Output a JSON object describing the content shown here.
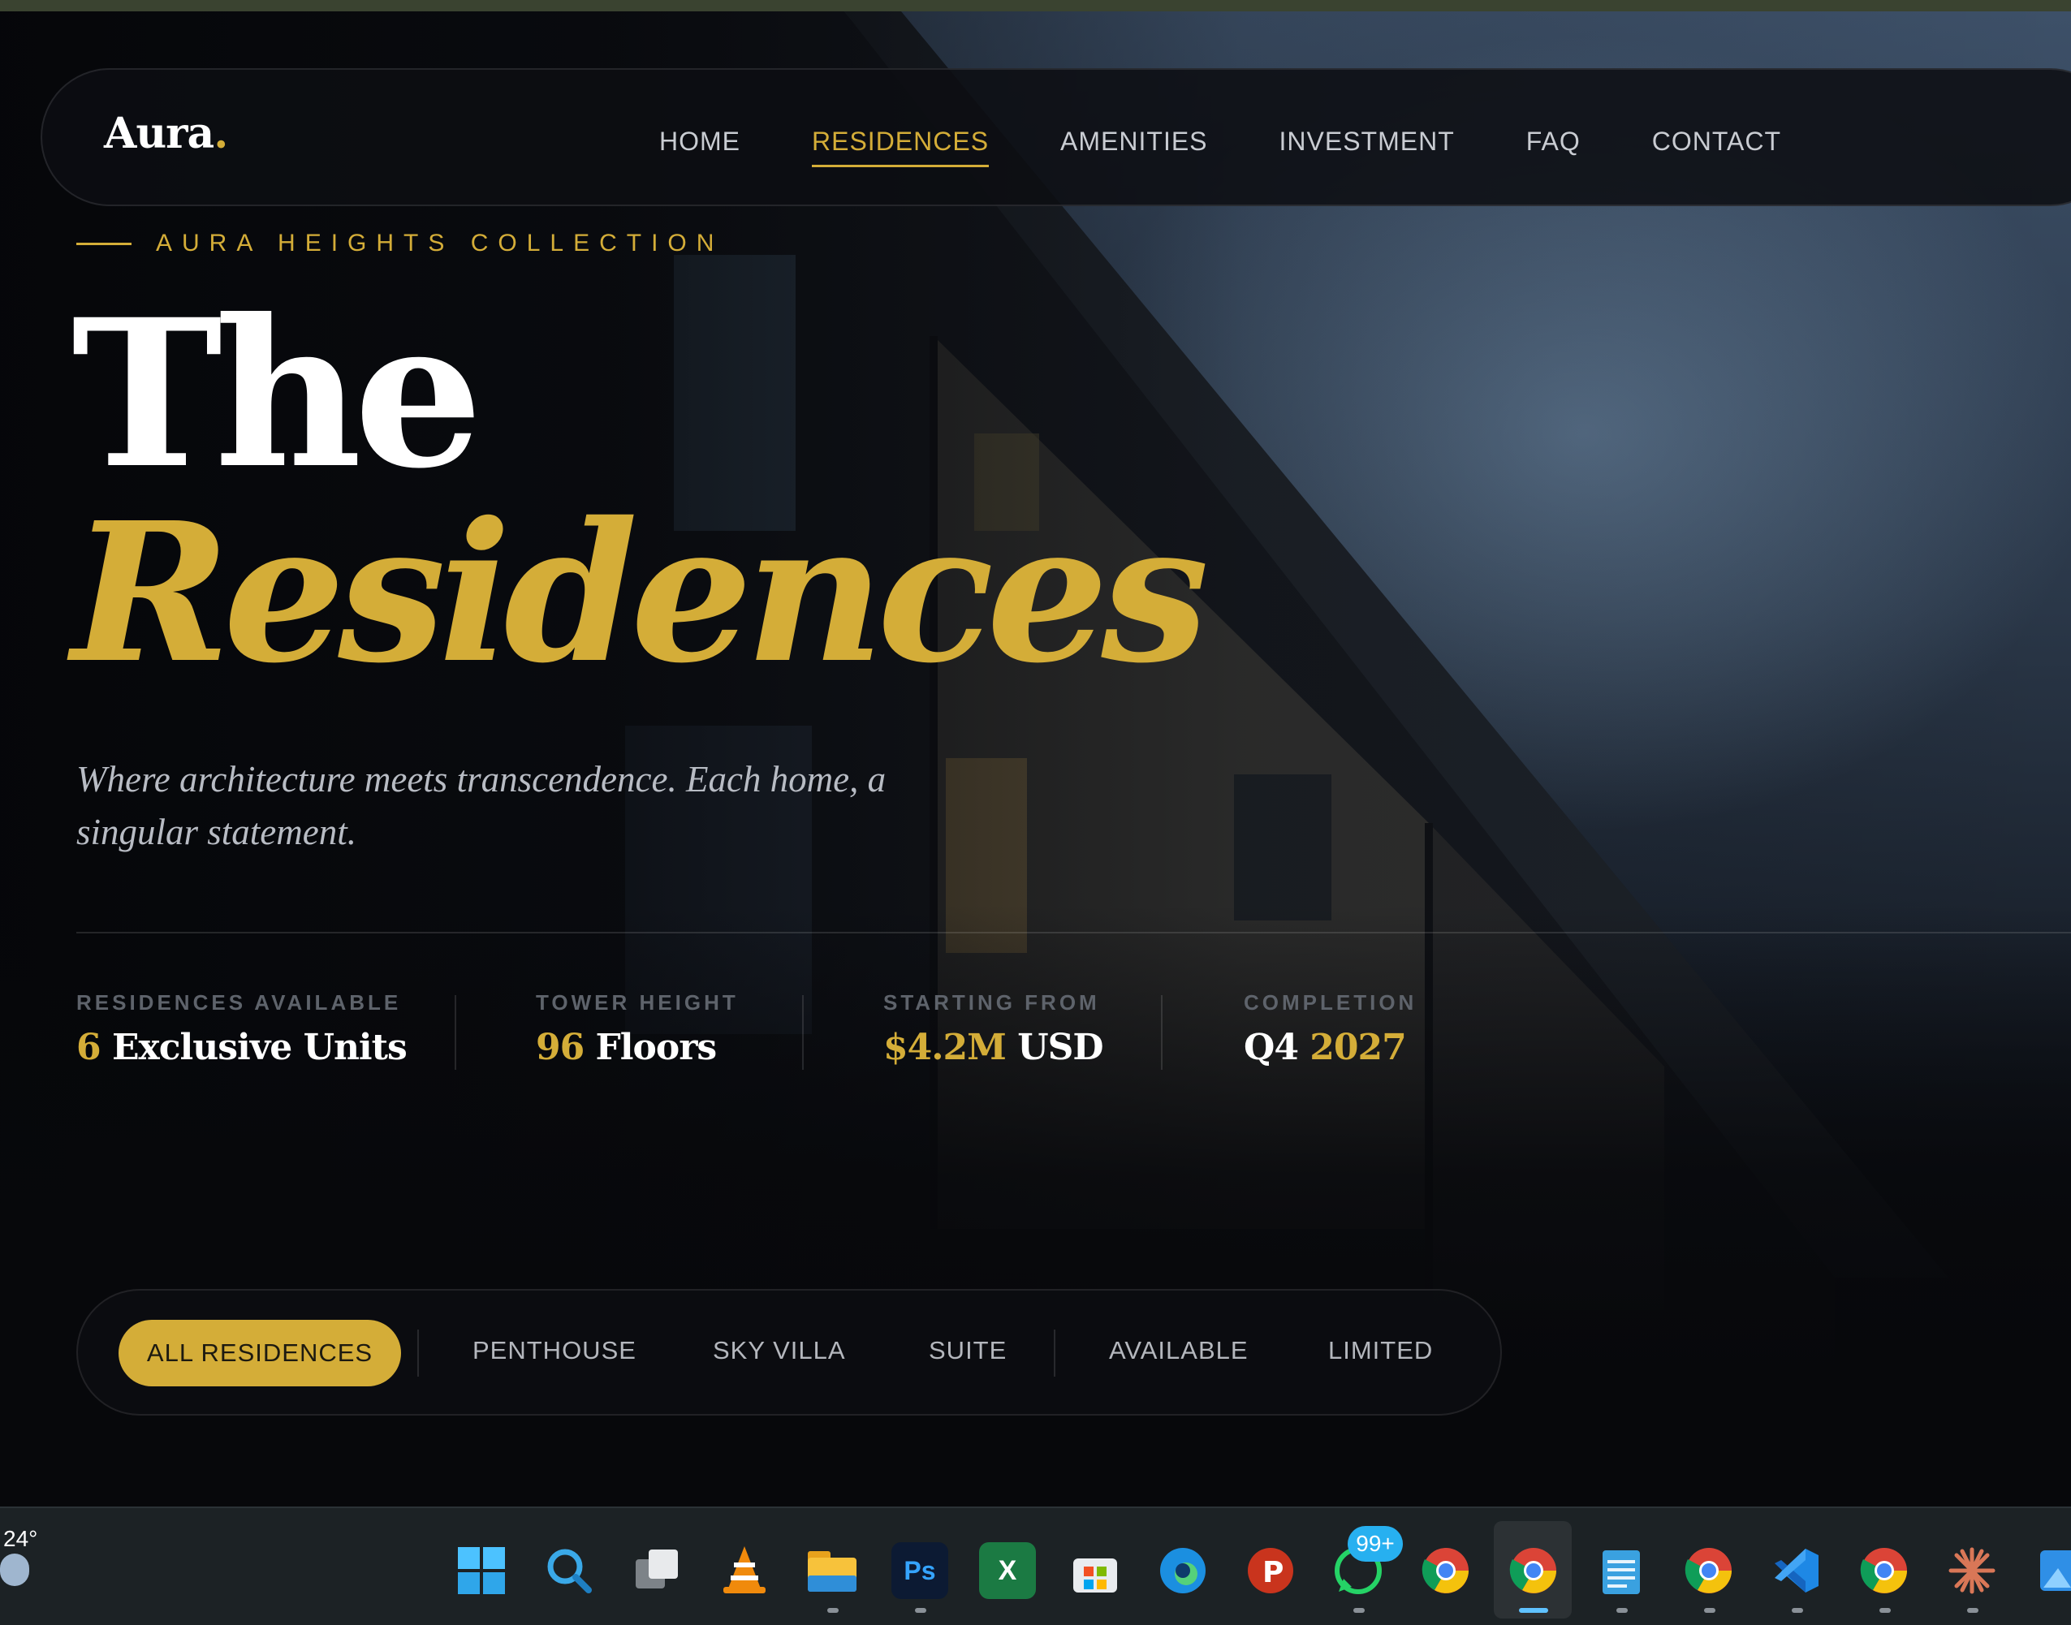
{
  "brand": {
    "name": "Aura",
    "dot": "."
  },
  "nav": {
    "items": [
      {
        "label": "HOME"
      },
      {
        "label": "RESIDENCES",
        "active": true
      },
      {
        "label": "AMENITIES"
      },
      {
        "label": "INVESTMENT"
      },
      {
        "label": "FAQ"
      },
      {
        "label": "CONTACT"
      }
    ]
  },
  "hero": {
    "eyebrow": "AURA HEIGHTS COLLECTION",
    "title_line1": "The",
    "title_line2": "Residences",
    "tagline": "Where architecture meets transcendence. Each home, a singular statement."
  },
  "stats": [
    {
      "label": "RESIDENCES AVAILABLE",
      "value_a": "6",
      "value_b": " Exclusive Units"
    },
    {
      "label": "TOWER HEIGHT",
      "value_a": "96",
      "value_b": " Floors"
    },
    {
      "label": "STARTING FROM",
      "value_a": "$4.2M",
      "value_b": " USD"
    },
    {
      "label": "COMPLETION",
      "value_a": "Q4 ",
      "value_b": "2027"
    }
  ],
  "filters": {
    "active": "ALL RESIDENCES",
    "items": [
      "PENTHOUSE",
      "SKY VILLA",
      "SUITE",
      "AVAILABLE",
      "LIMITED"
    ]
  },
  "taskbar": {
    "weather_temp": "24°",
    "whatsapp_badge": "99+",
    "icons": [
      "windows-start-icon",
      "search-icon",
      "task-view-icon",
      "vlc-icon",
      "file-explorer-icon",
      "photoshop-icon",
      "excel-icon",
      "microsoft-store-icon",
      "edge-icon",
      "p-app-icon",
      "whatsapp-icon",
      "chrome-icon",
      "chrome-active-icon",
      "notepad-icon",
      "chrome-profile-icon",
      "vscode-icon",
      "chrome-icon-2",
      "claude-icon",
      "photos-icon"
    ]
  },
  "colors": {
    "accent": "#d4ad38",
    "background": "#07080b",
    "nav_text": "#c9ccd2"
  }
}
